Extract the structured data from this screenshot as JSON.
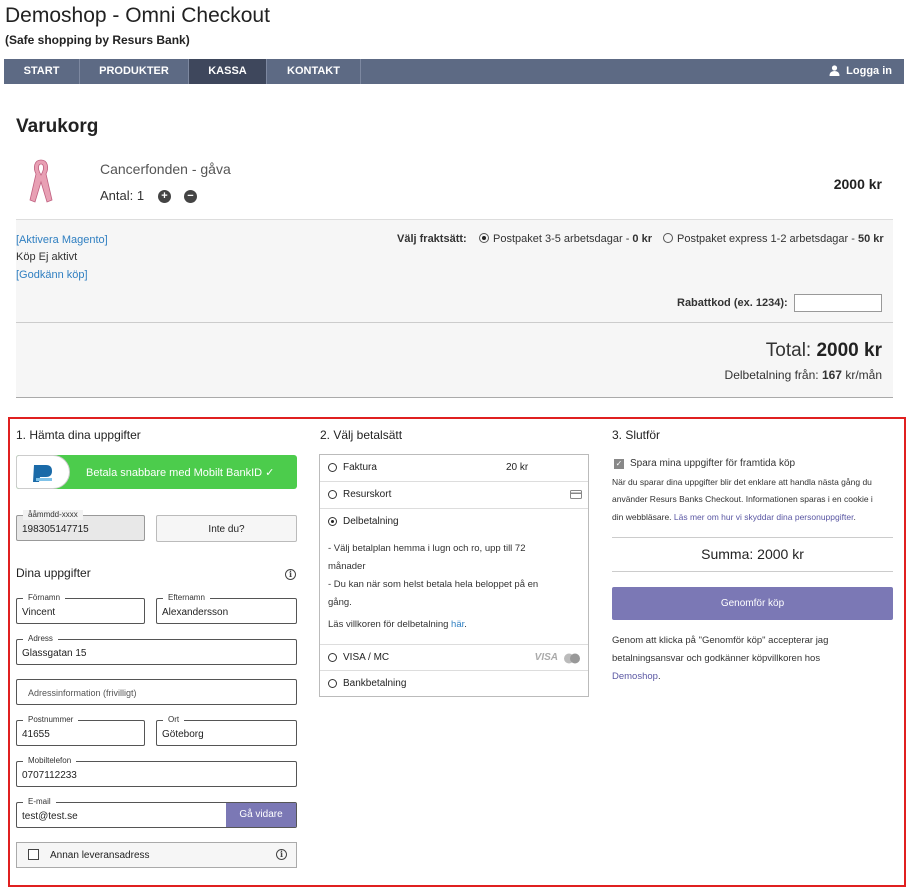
{
  "site": {
    "title": "Demoshop - Omni Checkout",
    "subtitle": "(Safe shopping by Resurs Bank)"
  },
  "nav": {
    "items": [
      {
        "label": "START"
      },
      {
        "label": "PRODUKTER"
      },
      {
        "label": "KASSA",
        "active": true
      },
      {
        "label": "KONTAKT"
      }
    ],
    "login": "Logga in",
    "login_icon": "user-icon"
  },
  "cart": {
    "title": "Varukorg",
    "product": {
      "name": "Cancerfonden - gåva",
      "qty_label": "Antal: 1",
      "price": "2000 kr",
      "plus": "+",
      "minus": "−",
      "image_icon": "pink-ribbon-icon"
    },
    "links": {
      "aktivera": "[Aktivera Magento]",
      "status": "Köp Ej aktivt",
      "godkann": "[Godkänn köp]"
    },
    "shipping": {
      "label": "Välj fraktsätt:",
      "options": [
        {
          "text": "Postpaket 3-5 arbetsdagar - ",
          "price": "0 kr",
          "selected": true
        },
        {
          "text": "Postpaket express 1-2 arbetsdagar - ",
          "price": "50 kr",
          "selected": false
        }
      ]
    },
    "discount_label": "Rabattkod (ex. 1234):",
    "discount_value": "",
    "total_label": "Total: ",
    "total_value": "2000 kr",
    "delbetalning_prefix": "Delbetalning från: ",
    "delbetalning_value": "167",
    "delbetalning_suffix": " kr/mån"
  },
  "checkout": {
    "step1": {
      "heading": "1. Hämta dina uppgifter",
      "bankid_button": "Betala snabbare med Mobilt BankID  ✓",
      "ssn": {
        "label": "ååmmdd-xxxx",
        "value": "198305147715"
      },
      "not_you": "Inte du?",
      "dina_heading": "Dina uppgifter",
      "fornamn": {
        "label": "Förnamn",
        "value": "Vincent"
      },
      "efternamn": {
        "label": "Efternamn",
        "value": "Alexandersson"
      },
      "adress": {
        "label": "Adress",
        "value": "Glassgatan 15"
      },
      "adressinfo": {
        "placeholder": "Adressinformation (frivilligt)"
      },
      "postnummer": {
        "label": "Postnummer",
        "value": "41655"
      },
      "ort": {
        "label": "Ort",
        "value": "Göteborg"
      },
      "mobil": {
        "label": "Mobiltelefon",
        "value": "0707112233"
      },
      "email": {
        "label": "E-mail",
        "value": "test@test.se"
      },
      "ga_vidare": "Gå vidare",
      "annan": "Annan leveransadress",
      "info_glyph": "i"
    },
    "step2": {
      "heading": "2. Välj betalsätt",
      "methods": [
        {
          "label": "Faktura",
          "extra": "20 kr"
        },
        {
          "label": "Resurskort",
          "icon": "card-icon"
        },
        {
          "label": "Delbetalning",
          "selected": true
        },
        {
          "label": "VISA / MC",
          "logo": "VISA"
        },
        {
          "label": "Bankbetalning"
        }
      ],
      "desc1": "- Välj betalplan hemma i lugn och ro, upp till 72",
      "desc1b": "månader",
      "desc2": "- Du kan när som helst betala hela beloppet på en",
      "desc2b": "gång.",
      "terms_prefix": "Läs villkoren för delbetalning ",
      "terms_link": "här",
      "terms_suffix": "."
    },
    "step3": {
      "heading": "3. Slutför",
      "save_label": "Spara mina uppgifter för framtida köp",
      "save_checked": true,
      "info1": "När du sparar dina uppgifter blir det enklare att handla nästa gång du",
      "info2": "använder Resurs Banks Checkout. Informationen sparas i en cookie i",
      "info3": "din webbläsare. ",
      "info_link": "Läs mer om hur vi skyddar dina personuppgifter",
      "info_end": ".",
      "summa": "Summa: 2000 kr",
      "submit": "Genomför köp",
      "terms1": "Genom att klicka på \"Genomför köp\" accepterar jag",
      "terms2": "betalningsansvar och godkänner köpvillkoren hos",
      "terms_link": "Demoshop",
      "terms_end": "."
    }
  },
  "colors": {
    "nav": "#5d6a84",
    "nav_active": "#3e475c",
    "accent": "#7b78b5",
    "bankid": "#4ccc4c",
    "border_highlight": "#e02020",
    "link": "#2f7fc1"
  }
}
